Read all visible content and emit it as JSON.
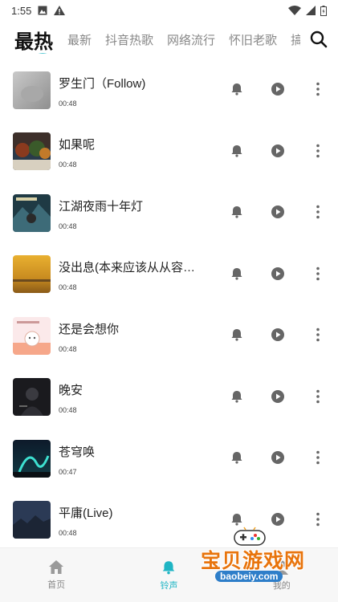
{
  "status_bar": {
    "time": "1:55"
  },
  "tabs": [
    {
      "label": "最热",
      "active": true
    },
    {
      "label": "最新",
      "active": false
    },
    {
      "label": "抖音热歌",
      "active": false
    },
    {
      "label": "网络流行",
      "active": false
    },
    {
      "label": "怀旧老歌",
      "active": false
    },
    {
      "label": "搞笑",
      "active": false
    }
  ],
  "songs": [
    {
      "title": "罗生门（Follow)",
      "duration": "00:48"
    },
    {
      "title": "如果呢",
      "duration": "00:48"
    },
    {
      "title": "江湖夜雨十年灯",
      "duration": "00:48"
    },
    {
      "title": "没出息(本来应该从从容容...",
      "duration": "00:48"
    },
    {
      "title": "还是会想你",
      "duration": "00:48"
    },
    {
      "title": "晚安",
      "duration": "00:48"
    },
    {
      "title": "苍穹唤",
      "duration": "00:47"
    },
    {
      "title": "平庸(Live)",
      "duration": "00:48"
    }
  ],
  "bottom_nav": [
    {
      "label": "首页",
      "icon": "home-icon",
      "active": false
    },
    {
      "label": "铃声",
      "icon": "bell-icon",
      "active": true
    },
    {
      "label": "我的",
      "icon": "user-icon",
      "active": false
    }
  ],
  "watermark": {
    "text": "宝贝游戏网",
    "url": "baobeiy.com"
  },
  "colors": {
    "accent": "#1fb5c4",
    "icon_gray": "#666666",
    "watermark_orange": "#e8740c"
  }
}
